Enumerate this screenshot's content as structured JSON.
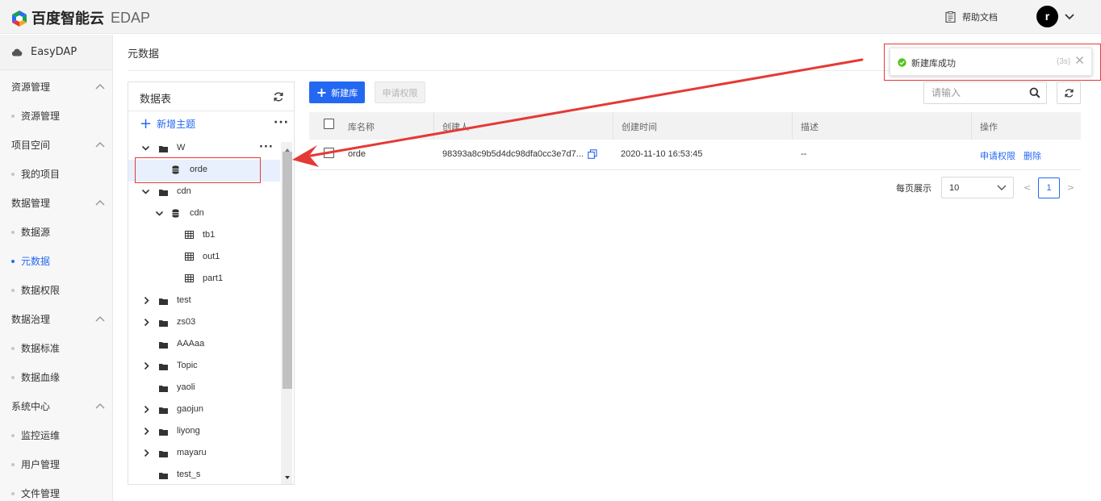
{
  "header": {
    "brand_name": "百度智能云",
    "product": "EDAP",
    "help_label": "帮助文档",
    "avatar_letter": "r"
  },
  "sidebar": {
    "app_name": "EasyDAP",
    "groups": [
      {
        "label": "资源管理",
        "items": [
          "资源管理"
        ]
      },
      {
        "label": "项目空间",
        "items": [
          "我的项目"
        ]
      },
      {
        "label": "数据管理",
        "items": [
          "数据源",
          "元数据",
          "数据权限"
        ]
      },
      {
        "label": "数据治理",
        "items": [
          "数据标准",
          "数据血缘"
        ]
      },
      {
        "label": "系统中心",
        "items": [
          "监控运维",
          "用户管理",
          "文件管理"
        ]
      }
    ],
    "active_item": "元数据"
  },
  "page": {
    "title": "元数据"
  },
  "tree": {
    "title": "数据表",
    "add_topic_label": "新增主题",
    "more_glyph": "···",
    "nodes": [
      "W",
      "orde",
      "cdn",
      "cdn",
      "tb1",
      "out1",
      "part1",
      "test",
      "zs03",
      "AAAaa",
      "Topic",
      "yaoli",
      "gaojun",
      "liyong",
      "mayaru",
      "test_s"
    ],
    "selected_node": "orde"
  },
  "toolbar": {
    "new_db_label": "新建库",
    "apply_perm_label": "申请权限",
    "search_placeholder": "请输入"
  },
  "table": {
    "columns": [
      "库名称",
      "创建人",
      "创建时间",
      "描述",
      "操作"
    ],
    "rows": [
      {
        "name": "orde",
        "creator": "98393a8c9b5d4dc98dfa0cc3e7d7...",
        "created_at": "2020-11-10 16:53:45",
        "description": "--",
        "actions": [
          "申请权限",
          "删除"
        ]
      }
    ]
  },
  "pagination": {
    "page_size_label": "每页展示",
    "page_size": "10",
    "prev": "<",
    "current": "1",
    "next": ">"
  },
  "toast": {
    "message": "新建库成功",
    "countdown": "(3s)"
  },
  "colors": {
    "primary": "#2468f2",
    "success": "#52c41a",
    "annotation": "#e53935"
  }
}
